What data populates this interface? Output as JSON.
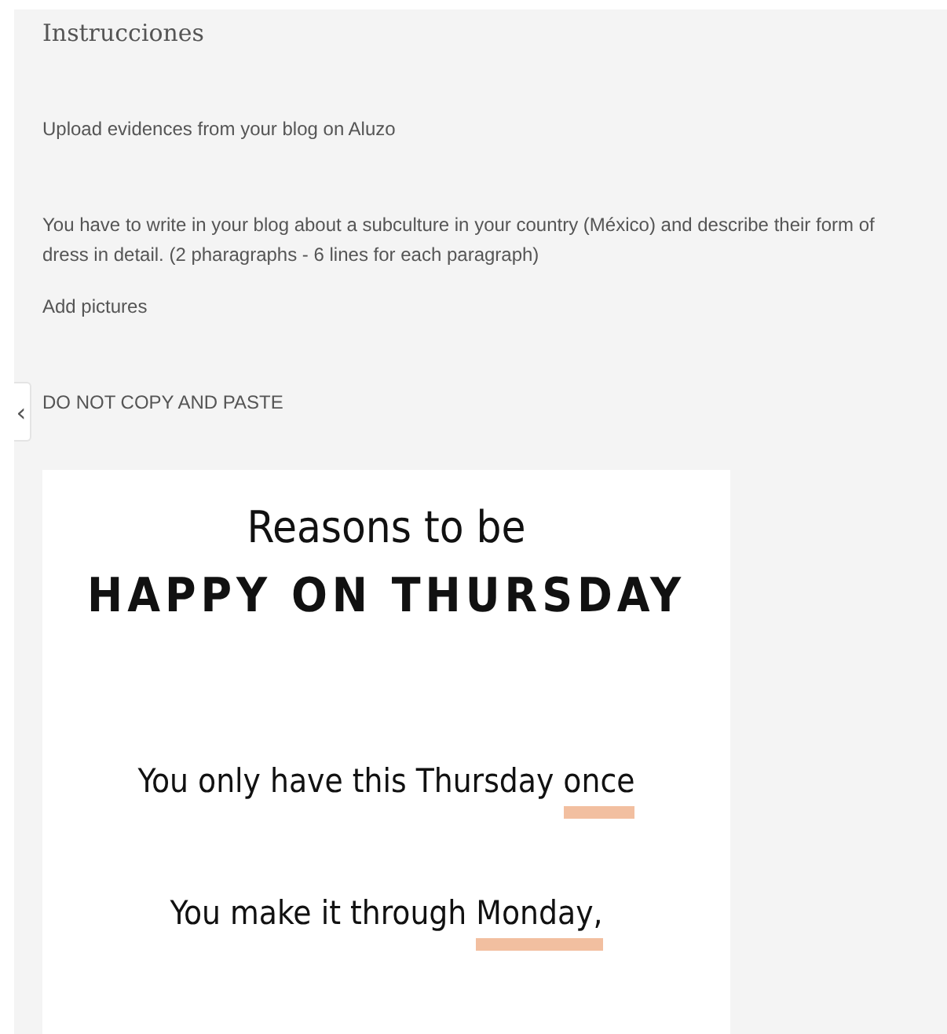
{
  "panel": {
    "title": "Instrucciones",
    "collapse_toggle": "‹",
    "paragraphs": [
      {
        "text": "Upload evidences from your blog on Aluzo"
      },
      {
        "text": "You have to write in your blog about a subculture in your country (México)  and describe their form of dress in detail. (2 pharagraphs - 6 lines for each paragraph)"
      },
      {
        "text": "Add pictures"
      },
      {
        "text": "DO NOT COPY AND PASTE"
      }
    ]
  },
  "poster": {
    "heading": "Reasons to be",
    "headline": "HAPPY ON THURSDAY",
    "lines": [
      {
        "segments": [
          {
            "text": "You only have this Thursday ",
            "highlighted": false
          },
          {
            "text": "once",
            "highlighted": true
          }
        ]
      },
      {
        "segments": [
          {
            "text": "You make it through ",
            "highlighted": false
          },
          {
            "text": "Monday,",
            "highlighted": true
          }
        ]
      }
    ]
  }
}
